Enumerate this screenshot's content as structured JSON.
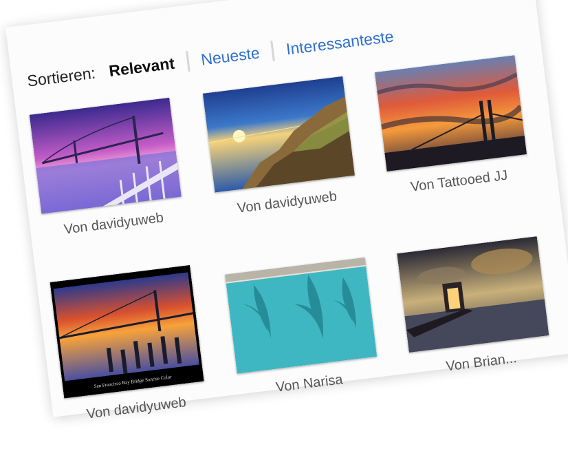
{
  "sort": {
    "label": "Sortieren:",
    "options": [
      {
        "label": "Relevant",
        "active": true
      },
      {
        "label": "Neueste",
        "active": false
      },
      {
        "label": "Interessanteste",
        "active": false
      }
    ]
  },
  "photos": [
    {
      "caption": "Von davidyuweb",
      "subject": "purple bridge dusk"
    },
    {
      "caption": "Von davidyuweb",
      "subject": "sunset coastal rocks"
    },
    {
      "caption": "Von Tattooed JJ",
      "subject": "orange sunset clouds bridge"
    },
    {
      "caption": "Von davidyuweb",
      "subject": "bay bridge sunrise pilings",
      "inner_text": "San Francisco Bay Bridge Sunrise Color"
    },
    {
      "caption": "Von Narisa",
      "subject": "pool palm reflection"
    },
    {
      "caption": "Von Brian...",
      "subject": "pier sunset clouds"
    }
  ],
  "colors": {
    "link": "#2f6fd0",
    "active": "#111111",
    "caption": "#555555"
  }
}
